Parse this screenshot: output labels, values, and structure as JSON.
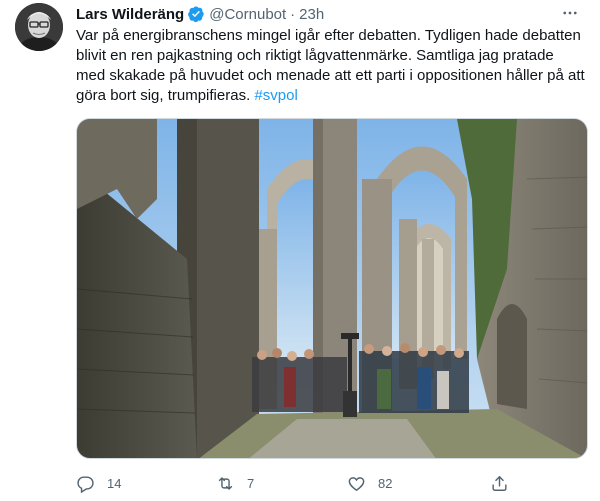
{
  "tweet": {
    "author_name": "Lars Wilderäng",
    "handle": "@Cornubot",
    "separator": "·",
    "time": "23h",
    "text": "Var på energibranschens mingel igår efter debatten. Tydligen hade debatten blivit en ren pajkastning och riktigt lågvattenmärke. Samtliga jag pratade med skakade på huvudet och menade att ett parti i oppositionen håller på att göra bort sig, trumpifieras.",
    "hashtag": "#svpol",
    "media_alt": "",
    "reply_count": "14",
    "retweet_count": "7",
    "like_count": "82"
  },
  "colors": {
    "accent": "#1d9bf0",
    "secondary_text": "#536471",
    "primary_text": "#0f1419"
  },
  "icons": [
    "verified-badge-icon",
    "more-icon",
    "reply-icon",
    "retweet-icon",
    "like-icon",
    "share-icon"
  ]
}
